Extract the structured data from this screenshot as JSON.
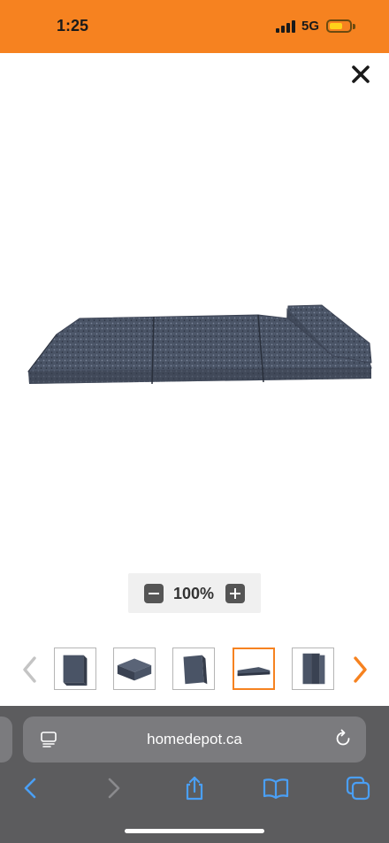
{
  "status_bar": {
    "time": "1:25",
    "network": "5G",
    "background_color": "#f68220",
    "battery_color": "#ffd21a"
  },
  "viewer": {
    "close_icon": "close-icon",
    "main_image": "folding-mattress-unfolded",
    "zoom_out_icon": "minus-icon",
    "zoom_level": "100%",
    "zoom_in_icon": "plus-icon",
    "accent_color": "#f68220"
  },
  "thumbnails": {
    "prev_icon": "chevron-left-icon",
    "next_icon": "chevron-right-icon",
    "items": [
      {
        "name": "mattress-folded-standing",
        "selected": false
      },
      {
        "name": "mattress-folded-flat",
        "selected": false
      },
      {
        "name": "mattress-folded-angle",
        "selected": false
      },
      {
        "name": "mattress-unfolded",
        "selected": true
      },
      {
        "name": "mattress-stacked",
        "selected": false
      }
    ]
  },
  "browser": {
    "url": "homedepot.ca",
    "toolbar": [
      "back-icon",
      "forward-icon",
      "share-icon",
      "bookmarks-icon",
      "tabs-icon"
    ]
  }
}
